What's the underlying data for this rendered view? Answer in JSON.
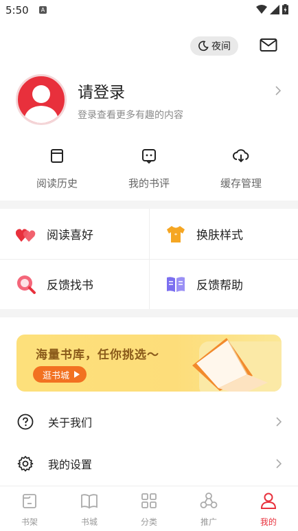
{
  "status_bar": {
    "time": "5:50",
    "notif_badge": "A"
  },
  "top_actions": {
    "night_label": "夜间"
  },
  "profile": {
    "title": "请登录",
    "subtitle": "登录查看更多有趣的内容"
  },
  "quick_actions": [
    {
      "label": "阅读历史",
      "icon": "book-history-icon"
    },
    {
      "label": "我的书评",
      "icon": "comment-icon"
    },
    {
      "label": "缓存管理",
      "icon": "cloud-download-icon"
    }
  ],
  "grid": [
    {
      "label": "阅读喜好",
      "icon": "hearts-icon"
    },
    {
      "label": "换肤样式",
      "icon": "tshirt-icon"
    },
    {
      "label": "反馈找书",
      "icon": "search-book-icon"
    },
    {
      "label": "反馈帮助",
      "icon": "open-book-icon"
    }
  ],
  "banner": {
    "title": "海量书库，任你挑选～",
    "button_label": "逛书城"
  },
  "list": [
    {
      "label": "关于我们",
      "icon": "question-circle-icon"
    },
    {
      "label": "我的设置",
      "icon": "gear-icon"
    }
  ],
  "tabs": [
    {
      "label": "书架",
      "icon": "bookshelf-icon",
      "active": false
    },
    {
      "label": "书城",
      "icon": "book-open-icon",
      "active": false
    },
    {
      "label": "分类",
      "icon": "grid-icon",
      "active": false
    },
    {
      "label": "推广",
      "icon": "share-icon",
      "active": false
    },
    {
      "label": "我的",
      "icon": "user-icon",
      "active": true
    }
  ],
  "colors": {
    "accent": "#e8303c",
    "banner_button": "#f27121",
    "banner_text": "#8a5a1a"
  }
}
